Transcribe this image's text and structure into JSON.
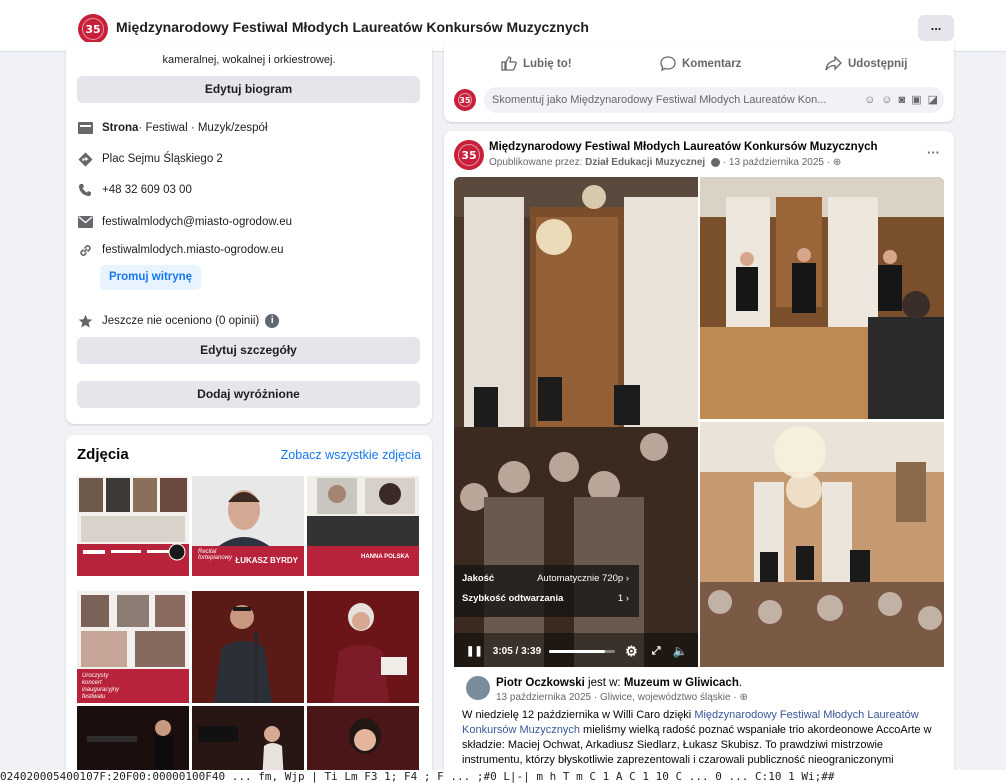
{
  "page": {
    "title": "Międzynarodowy Festiwal Młodych Laureatów Konkursów Muzycznych",
    "logo_text": "35",
    "more_label": "..."
  },
  "intro": {
    "bio_text": "kameralnej, wokalnej i orkiestrowej.",
    "edit_bio_label": "Edytuj biogram",
    "category_bold": "Strona",
    "category_rest": " · Festiwal · Muzyk/zespół",
    "address": "Plac Sejmu Śląskiego 2",
    "phone": "+48 32 609 03 00",
    "email": "festiwalmlodych@miasto-ogrodow.eu",
    "website": "festiwalmlodych.miasto-ogrodow.eu",
    "promote_label": "Promuj witrynę",
    "rating": "Jeszcze nie oceniono (0 opinii)",
    "edit_details_label": "Edytuj szczegóły",
    "add_featured_label": "Dodaj wyróżnione"
  },
  "photos": {
    "title": "Zdjęcia",
    "see_all": "Zobacz wszystkie zdjęcia",
    "thumbs": [
      {
        "caption": "",
        "bg": "#b8223a"
      },
      {
        "caption": "ŁUKASZ BYRDY",
        "sub": "Recital fortepianowy",
        "bg": "#b8223a"
      },
      {
        "caption": "HANNA POLSKA",
        "bg": "#b8223a"
      },
      {
        "caption": "Uroczysty koncert inauguracyjny festiwalu",
        "bg": "#b8223a"
      },
      {
        "caption": "",
        "bg": "#5a1a16"
      },
      {
        "caption": "",
        "bg": "#6b1518"
      }
    ]
  },
  "prev_post": {
    "like_label": "Lubię to!",
    "comment_label": "Komentarz",
    "share_label": "Udostępnij",
    "comment_placeholder": "Skomentuj jako Międzynarodowy Festiwal Młodych Laureatów Kon..."
  },
  "post": {
    "author": "Międzynarodowy Festiwal Młodych Laureatów Konkursów Muzycznych",
    "published_by_prefix": "Opublikowane przez: ",
    "published_by": "Dział Edukacji Muzycznej",
    "date": " · 13 października 2025 ·",
    "more": "···",
    "video": {
      "quality_label": "Jakość",
      "quality_value": "Automatycznie 720p",
      "speed_label": "Szybkość odtwarzania",
      "speed_value": "1",
      "time": "3:05 / 3:39",
      "progress": 0.84
    },
    "shared_author": "Piotr Oczkowski",
    "shared_mid": " jest w: ",
    "shared_place": "Muzeum w Gliwicach",
    "shared_meta": "13 października 2025 · Gliwice, województwo śląskie ·",
    "text_1": "W niedzielę 12 października w Willi Caro dzięki ",
    "text_link": "Międzynarodowy Festiwal Młodych Laureatów Konkursów Muzycznych",
    "text_2": " mieliśmy wielką radość poznać wspaniałe trio akordeonowe AccoArte w składzie: Maciej Ochwat, Arkadiusz Siedlarz, Łukasz Skubisz. To prawdziwi mistrzowie instrumentu, którzy błyskotliwie zaprezentowali i czarowali publiczność nieograniczonymi"
  },
  "bottom_strip_text": "024020005400107F:20F00:00000100F40 ... fm,  Wjp | Ti Lm F3 1; F4 ; F ... ;#0 L|-| m  h  T m  C 1 A C 1 10 C  ... 0 ... C:10 1 Wi;##"
}
